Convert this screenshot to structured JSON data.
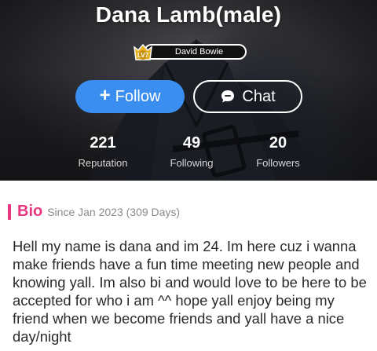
{
  "profile": {
    "name": "Dana Lamb(male)",
    "level_badge": "LV7",
    "custom_title": "David Bowie"
  },
  "actions": {
    "follow_label": "Follow",
    "chat_label": "Chat"
  },
  "stats": [
    {
      "value": "221",
      "label": "Reputation"
    },
    {
      "value": "49",
      "label": "Following"
    },
    {
      "value": "20",
      "label": "Followers"
    }
  ],
  "bio": {
    "heading": "Bio",
    "since": "Since Jan 2023 (309 Days)",
    "text": "Hell my name is dana and im 24. Im here cuz i wanna make friends have a fun time meeting new people and knowing yall. Im also bi and would love to be here to be accepted for who i am ^^ hope yall enjoy being my friend when we become friends and yall have a nice day/night"
  },
  "colors": {
    "follow_button": "#3a8ef0",
    "bio_accent": "#e8367f",
    "badge_gold": "#e8b21e"
  }
}
